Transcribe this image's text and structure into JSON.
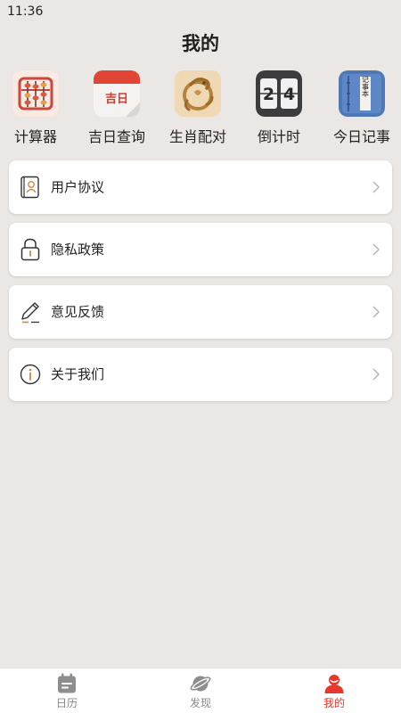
{
  "status_bar": {
    "time": "11:36"
  },
  "header": {
    "title": "我的"
  },
  "tools": [
    {
      "label": "计算器",
      "icon": "abacus-icon"
    },
    {
      "label": "吉日查询",
      "icon": "calendar-icon",
      "icon_text": "吉日"
    },
    {
      "label": "生肖配对",
      "icon": "dragon-icon"
    },
    {
      "label": "倒计时",
      "icon": "flip-clock-icon",
      "icon_text": [
        "2",
        "4"
      ]
    },
    {
      "label": "今日记事",
      "icon": "notebook-icon",
      "icon_text": "记事本"
    }
  ],
  "menu": [
    {
      "label": "用户协议",
      "icon": "user-agreement-icon"
    },
    {
      "label": "隐私政策",
      "icon": "lock-icon"
    },
    {
      "label": "意见反馈",
      "icon": "pencil-icon"
    },
    {
      "label": "关于我们",
      "icon": "info-icon"
    }
  ],
  "tab_bar": [
    {
      "label": "日历",
      "icon": "calendar-tab-icon",
      "active": false
    },
    {
      "label": "发现",
      "icon": "planet-icon",
      "active": false
    },
    {
      "label": "我的",
      "icon": "profile-icon",
      "active": true
    }
  ],
  "colors": {
    "accent": "#e8382b",
    "background": "#ebe7e4",
    "card": "#ffffff"
  }
}
